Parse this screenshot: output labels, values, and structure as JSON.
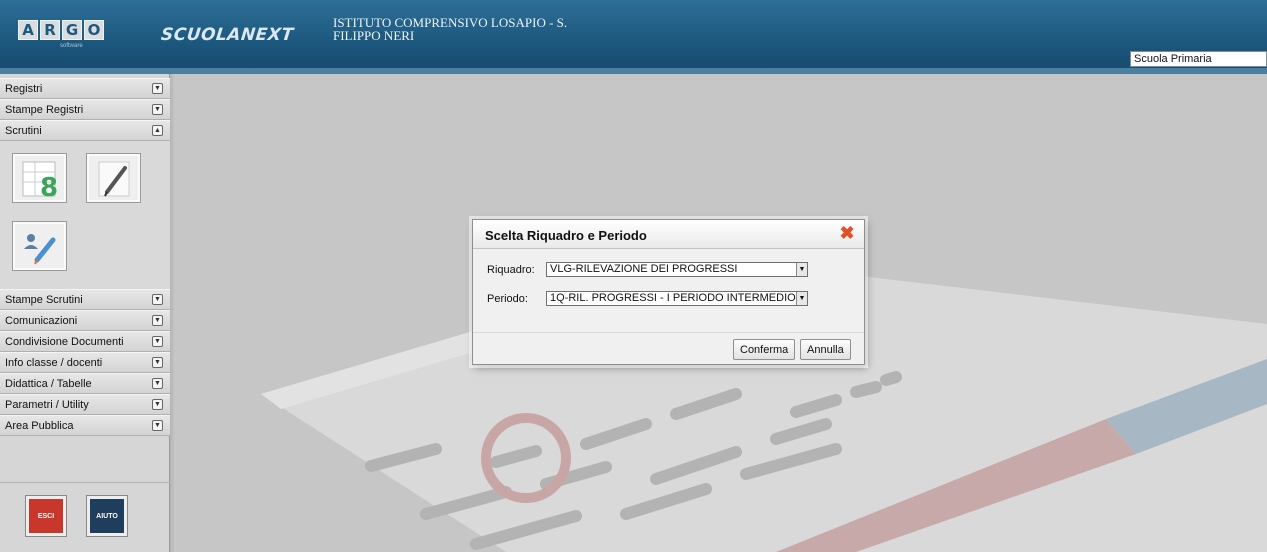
{
  "header": {
    "logo_letters": [
      "A",
      "R",
      "G",
      "O"
    ],
    "logo_sub": "software",
    "app_name": "SCUOLANEXT",
    "school_name": "ISTITUTO COMPRENSIVO LOSAPIO - S. FILIPPO NERI",
    "school_selector_value": "Scuola Primaria"
  },
  "sidebar": {
    "items": [
      {
        "label": "Registri"
      },
      {
        "label": "Stampe Registri"
      },
      {
        "label": "Scrutini"
      },
      {
        "label": "Stampe Scrutini"
      },
      {
        "label": "Comunicazioni"
      },
      {
        "label": "Condivisione Documenti"
      },
      {
        "label": "Info classe / docenti"
      },
      {
        "label": "Didattica / Tabelle"
      },
      {
        "label": "Parametri / Utility"
      },
      {
        "label": "Area Pubblica"
      }
    ],
    "bottom": {
      "exit_label": "ESCI",
      "help_label": "AIUTO"
    }
  },
  "dialog": {
    "title": "Scelta Riquadro e Periodo",
    "riquadro_label": "Riquadro:",
    "riquadro_value": "VLG-RILEVAZIONE DEI PROGRESSI",
    "periodo_label": "Periodo:",
    "periodo_value": "1Q-RIL. PROGRESSI - I PERIODO INTERMEDIO",
    "confirm_label": "Conferma",
    "cancel_label": "Annulla"
  },
  "colors": {
    "header": "#1d587f",
    "sidebar": "#d6d6d6",
    "close_icon": "#e0502a",
    "exit_button": "#c9372c",
    "help_button": "#1f3d5c"
  }
}
